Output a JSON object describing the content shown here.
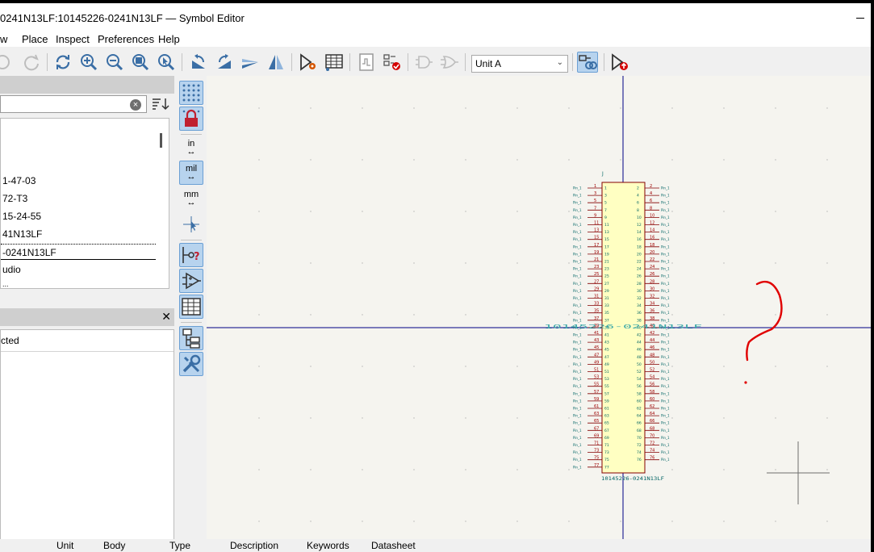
{
  "window": {
    "title": "0241N13LF:10145226-0241N13LF — Symbol Editor"
  },
  "menu": [
    "w",
    "Place",
    "Inspect",
    "Preferences",
    "Help"
  ],
  "toolbar": {
    "unit_select": "Unit A",
    "icons": [
      "undo-icon",
      "redo-icon",
      "refresh-icon",
      "zoom-in-icon",
      "zoom-out-icon",
      "zoom-fit-icon",
      "zoom-selection-icon",
      "rotate-ccw-icon",
      "rotate-cw-icon",
      "mirror-vertical-icon",
      "mirror-horizontal-icon",
      "symbol-properties-icon",
      "pin-table-icon",
      "simulation-model-icon",
      "symbol-checker-icon",
      "de-morgan-standard-icon",
      "de-morgan-alternate-icon",
      "sync-pins-icon",
      "update-symbol-icon"
    ]
  },
  "library": {
    "items": [
      "1-47-03",
      "72-T3",
      "15-24-55",
      "41N13LF",
      "-0241N13LF",
      "udio",
      "..."
    ],
    "selected_index": 4
  },
  "properties_panel": {
    "label": "cted"
  },
  "left_toolbar": {
    "unit_in": "in",
    "unit_mil": "mil",
    "unit_mm": "mm"
  },
  "symbol": {
    "reference": "J",
    "value": "10145226-0241N13LF",
    "center_field": "10145226-0241N13LF",
    "left_pin_numbers": [
      "1",
      "3",
      "5",
      "7",
      "9",
      "11",
      "13",
      "15",
      "17",
      "19",
      "21",
      "23",
      "25",
      "27",
      "29",
      "31",
      "33",
      "35",
      "37",
      "39",
      "41",
      "43",
      "45",
      "47",
      "49",
      "51",
      "53",
      "55",
      "57",
      "59",
      "61",
      "63",
      "65",
      "67",
      "69",
      "71",
      "73",
      "75",
      "77"
    ],
    "right_pin_numbers": [
      "2",
      "4",
      "6",
      "8",
      "10",
      "12",
      "14",
      "16",
      "18",
      "20",
      "22",
      "24",
      "26",
      "28",
      "30",
      "32",
      "34",
      "36",
      "38",
      "40",
      "42",
      "44",
      "46",
      "48",
      "50",
      "52",
      "54",
      "56",
      "58",
      "60",
      "62",
      "64",
      "66",
      "68",
      "70",
      "72",
      "74",
      "76"
    ],
    "pin_name": "Pin_1"
  },
  "annotation": {
    "mark": "?"
  },
  "footer": [
    "Unit",
    "Body",
    "Type",
    "Description",
    "Keywords",
    "Datasheet"
  ],
  "colors": {
    "canvas_bg": "#f5f4ef",
    "symbol_body_fill": "#ffffc2",
    "symbol_outline": "#840000",
    "pin_color": "#840000",
    "pin_number_color": "#a00000",
    "pin_name_color": "#006464",
    "axis_color": "#000084",
    "annotation_red": "#e00000",
    "active_tool": "#b7d3ee"
  }
}
